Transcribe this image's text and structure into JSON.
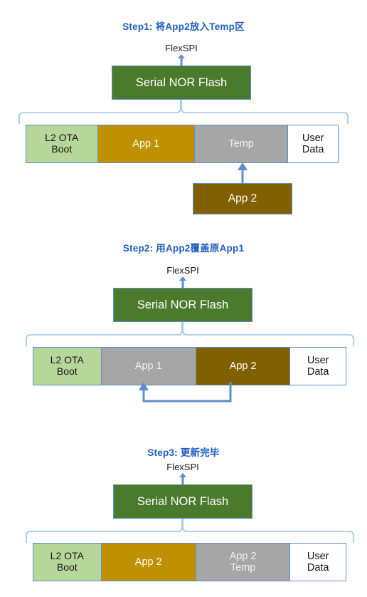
{
  "page": {
    "background": "#ffffff",
    "title_color": "#1f5fbf",
    "arrow_color": "#5b8fd0",
    "brace_color": "#9dc3e6"
  },
  "colors": {
    "flash_green": "#4a7a2c",
    "boot_green": "#b7d79a",
    "app1_gold": "#bf9000",
    "temp_gray": "#a6a6a6",
    "app2_brown": "#806000",
    "user_white": "#ffffff",
    "border_blue": "#5b8fd0"
  },
  "labels": {
    "flexspi": "FlexSPI",
    "flash": "Serial NOR Flash",
    "app2_incoming": "App 2"
  },
  "steps": [
    {
      "id": "step1",
      "title": "Step1: 将App2放入Temp区",
      "flexspi": "FlexSPI",
      "flash": "Serial NOR Flash",
      "segments": [
        {
          "name": "l2-ota-boot",
          "line1": "L2 OTA",
          "line2": "Boot",
          "color": "#b7d79a"
        },
        {
          "name": "app-1",
          "line1": "App 1",
          "line2": "",
          "color": "#bf9000"
        },
        {
          "name": "temp",
          "line1": "Temp",
          "line2": "",
          "color": "#a6a6a6"
        },
        {
          "name": "user-data",
          "line1": "User",
          "line2": "Data",
          "color": "#ffffff"
        }
      ],
      "incoming_box": "App 2"
    },
    {
      "id": "step2",
      "title": "Step2: 用App2覆盖原App1",
      "flexspi": "FlexSPI",
      "flash": "Serial NOR Flash",
      "segments": [
        {
          "name": "l2-ota-boot",
          "line1": "L2 OTA",
          "line2": "Boot",
          "color": "#b7d79a"
        },
        {
          "name": "app-1",
          "line1": "App 1",
          "line2": "",
          "color": "#a6a6a6"
        },
        {
          "name": "app-2",
          "line1": "App 2",
          "line2": "",
          "color": "#806000"
        },
        {
          "name": "user-data",
          "line1": "User",
          "line2": "Data",
          "color": "#ffffff"
        }
      ],
      "incoming_box": ""
    },
    {
      "id": "step3",
      "title": "Step3: 更新完毕",
      "flexspi": "FlexSPI",
      "flash": "Serial NOR Flash",
      "segments": [
        {
          "name": "l2-ota-boot",
          "line1": "L2 OTA",
          "line2": "Boot",
          "color": "#b7d79a"
        },
        {
          "name": "app-2",
          "line1": "App 2",
          "line2": "",
          "color": "#bf9000"
        },
        {
          "name": "app-2-temp",
          "line1": "App 2",
          "line2": "Temp",
          "color": "#a6a6a6"
        },
        {
          "name": "user-data",
          "line1": "User",
          "line2": "Data",
          "color": "#ffffff"
        }
      ],
      "incoming_box": ""
    }
  ]
}
